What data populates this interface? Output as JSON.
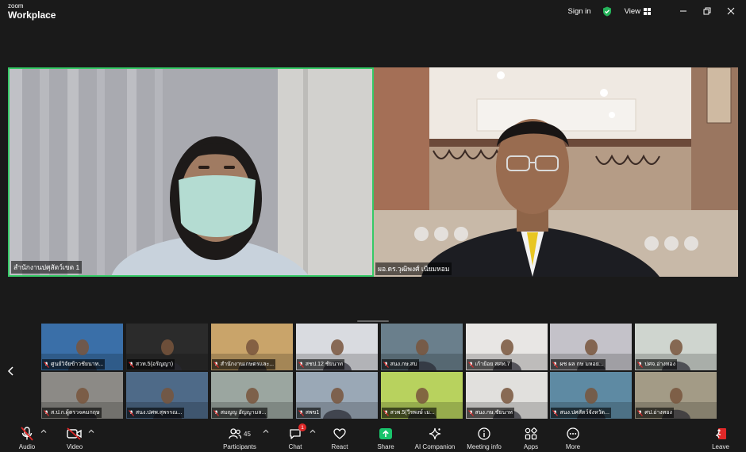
{
  "app": {
    "brand_small": "zoom",
    "brand_big": "Workplace"
  },
  "topbar": {
    "signin": "Sign in",
    "view": "View"
  },
  "colors": {
    "active_speaker_border": "#36c966",
    "muted_red": "#e02828",
    "share_green": "#19c36b",
    "background": "#1a1a1a"
  },
  "main_tiles": [
    {
      "name": "สำนักงานปศุสัตว์เขต 1"
    },
    {
      "name": "ผอ.ดร.วุฒิพงศ์ เนียมหอม"
    }
  ],
  "gallery": [
    {
      "name": "ศูนย์วิจัยข้าวชัยนาท...",
      "bg": "#3a6fa8"
    },
    {
      "name": "สวท.5(อรัญญา)",
      "bg": "#2b2b2b"
    },
    {
      "name": "สำนักงานเกษตรและ...",
      "bg": "#c9a46a"
    },
    {
      "name": "สชป.12 ชัยนาท",
      "bg": "#d9dbe0"
    },
    {
      "name": "สนง.กษ.สบ",
      "bg": "#6a7f8c"
    },
    {
      "name": "เก้าย้อย สศท.7",
      "bg": "#e8e6e4"
    },
    {
      "name": "ผช ผล กษ มหอย...",
      "bg": "#c4c2c9"
    },
    {
      "name": "ปศจ.อ่างทอง",
      "bg": "#cfd5cf"
    },
    {
      "name": "ส.ป.ก.ผู้ตรวจคมกฤษ",
      "bg": "#8c8a86"
    },
    {
      "name": "สนง.ปศพ.สุพรรณ...",
      "bg": "#4e6a88"
    },
    {
      "name": "สมญญ อัญญามล...",
      "bg": "#9ba6a0"
    },
    {
      "name": "สพข1",
      "bg": "#9aa8b6"
    },
    {
      "name": "สวพ.5(วีรพงษ์ เม...",
      "bg": "#b8d25e"
    },
    {
      "name": "สนง.กษ.ชัยนาท",
      "bg": "#e1e0dd"
    },
    {
      "name": "สนง.ปศสัตว์จังหวัด...",
      "bg": "#5e8aa3"
    },
    {
      "name": "ศป.อ่างทอง",
      "bg": "#a39b86"
    }
  ],
  "toolbar": {
    "audio": "Audio",
    "video": "Video",
    "participants": "Participants",
    "participant_count": "45",
    "chat": "Chat",
    "chat_badge": "1",
    "react": "React",
    "share": "Share",
    "ai_companion": "AI Companion",
    "meeting_info": "Meeting info",
    "apps": "Apps",
    "more": "More",
    "leave": "Leave"
  }
}
